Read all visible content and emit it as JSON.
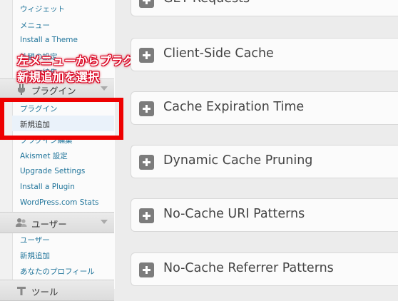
{
  "sidebar": {
    "items_top": [
      {
        "label": "ウィジェット"
      },
      {
        "label": "メニュー"
      },
      {
        "label": "Install a Theme"
      },
      {
        "label": "外観の設定"
      },
      {
        "label": "テーマ編集"
      }
    ],
    "plugins_header": {
      "label": "プラグイン",
      "icon": "plug-icon"
    },
    "plugins_items": [
      {
        "label": "プラグイン"
      },
      {
        "label": "新規追加"
      },
      {
        "label": "プラグイン編集"
      },
      {
        "label": "Akismet 設定"
      },
      {
        "label": "Upgrade Settings"
      },
      {
        "label": "Install a Plugin"
      },
      {
        "label": "WordPress.com Stats"
      }
    ],
    "users_header": {
      "label": "ユーザー",
      "icon": "users-icon"
    },
    "users_items": [
      {
        "label": "ユーザー"
      },
      {
        "label": "新規追加"
      },
      {
        "label": "あなたのプロフィール"
      }
    ],
    "tools_header": {
      "label": "ツール",
      "icon": "tools-icon"
    }
  },
  "annotation": {
    "line1": "左メニューからプラグインの",
    "line2": "新規追加を選択",
    "color": "#ee0000"
  },
  "panels": [
    {
      "title": "GET Requests"
    },
    {
      "title": "Client-Side Cache"
    },
    {
      "title": "Cache Expiration Time"
    },
    {
      "title": "Dynamic Cache Pruning"
    },
    {
      "title": "No-Cache URI Patterns"
    },
    {
      "title": "No-Cache Referrer Patterns"
    }
  ]
}
